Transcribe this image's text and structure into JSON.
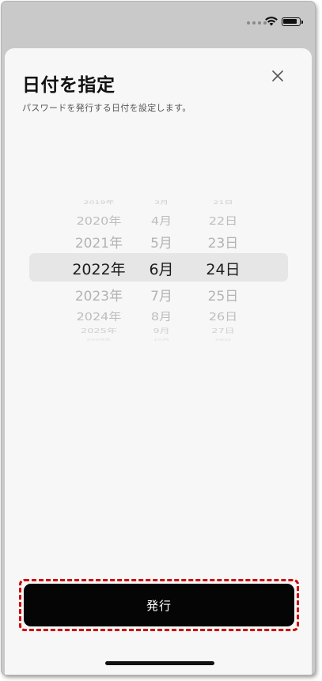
{
  "sheet": {
    "title": "日付を指定",
    "subtitle": "パスワードを発行する日付を設定します。"
  },
  "picker": {
    "years": [
      "2019年",
      "2020年",
      "2021年",
      "2022年",
      "2023年",
      "2024年",
      "2025年",
      "2026年"
    ],
    "months": [
      "3月",
      "4月",
      "5月",
      "6月",
      "7月",
      "8月",
      "9月",
      "10月"
    ],
    "days": [
      "21日",
      "22日",
      "23日",
      "24日",
      "25日",
      "26日",
      "27日",
      "28日"
    ],
    "selected": {
      "year": "2022年",
      "month": "6月",
      "day": "24日"
    }
  },
  "actions": {
    "issue_label": "発行"
  },
  "colors": {
    "highlight_border": "#d10000",
    "button_bg": "#050505",
    "sheet_bg": "#f7f7f7"
  },
  "icons": {
    "close": "close-icon",
    "wifi": "wifi-icon",
    "battery": "battery-icon"
  }
}
